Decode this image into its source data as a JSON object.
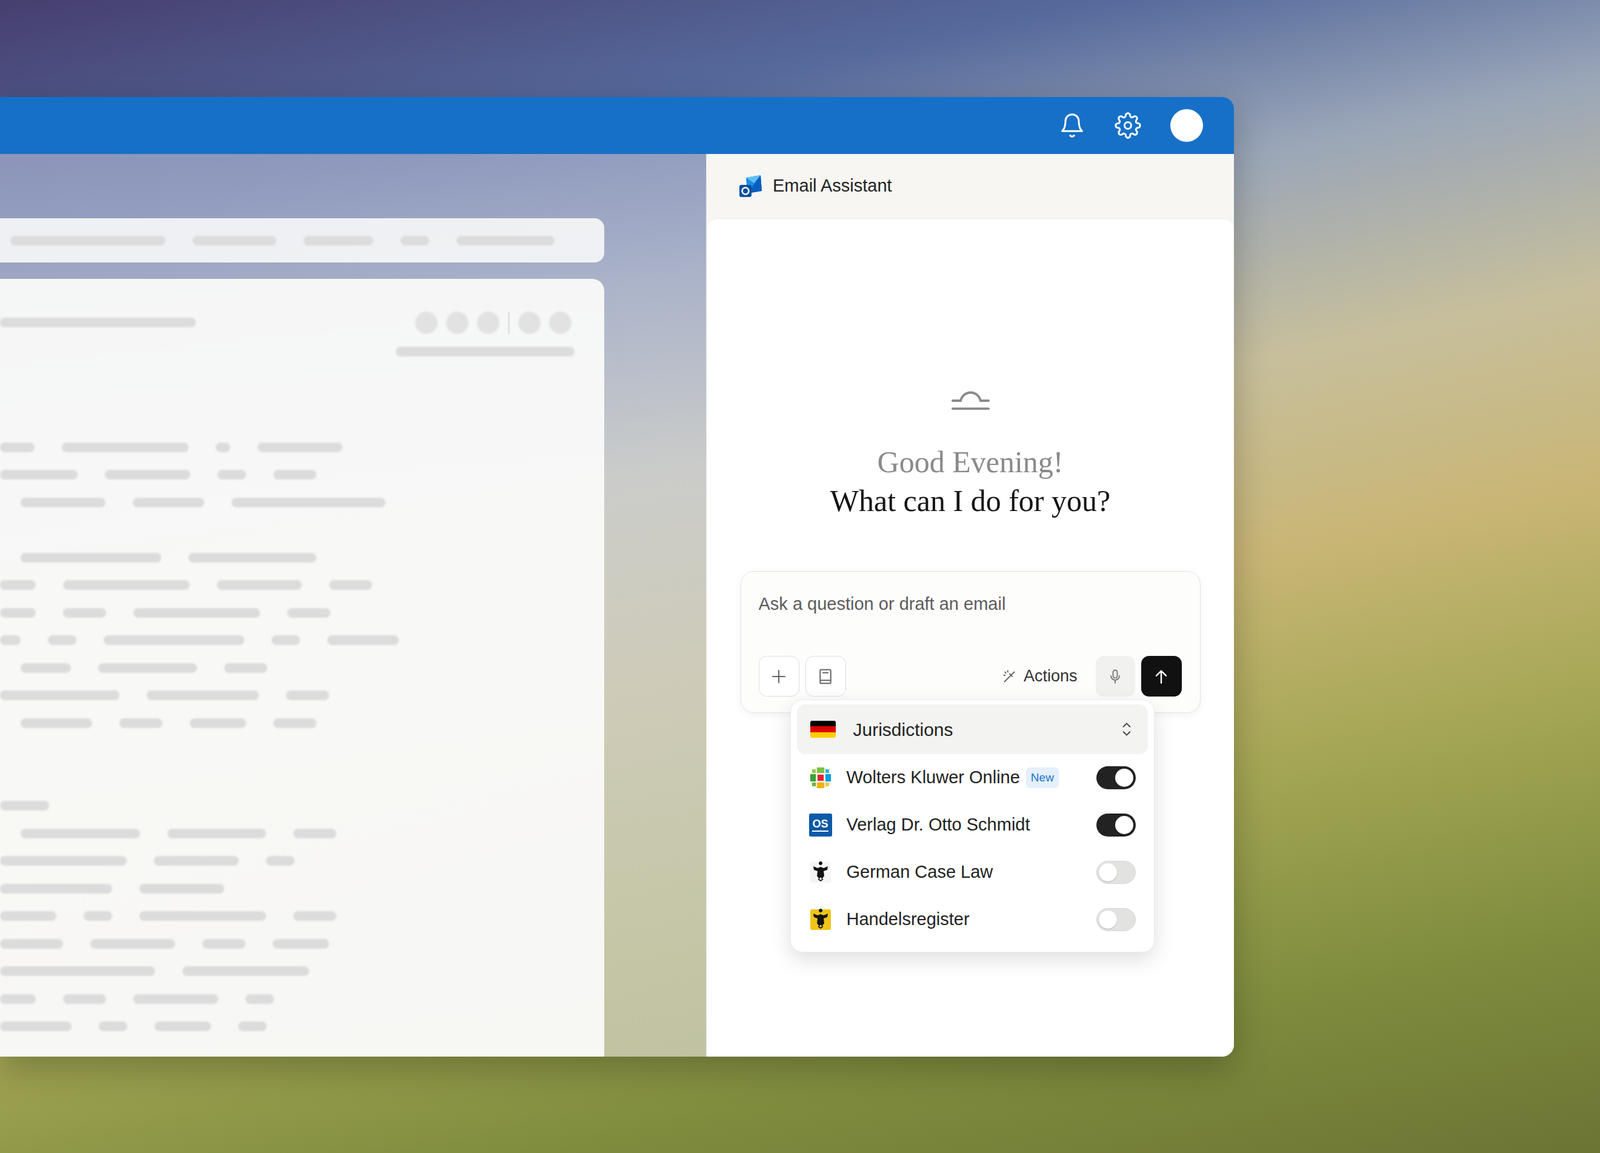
{
  "app": {
    "title": "Email Assistant"
  },
  "greeting": {
    "salutation": "Good Evening!",
    "prompt": "What can I do for you?"
  },
  "composer": {
    "placeholder": "Ask a question or draft an email",
    "actions_label": "Actions"
  },
  "jurisdictions": {
    "label": "Jurisdictions"
  },
  "sources": [
    {
      "name": "Wolters Kluwer Online",
      "badge": "New",
      "on": true
    },
    {
      "name": "Verlag Dr. Otto Schmidt",
      "logo_text": "OS",
      "on": true
    },
    {
      "name": "German Case Law",
      "on": false
    },
    {
      "name": "Handelsregister",
      "on": false
    }
  ]
}
